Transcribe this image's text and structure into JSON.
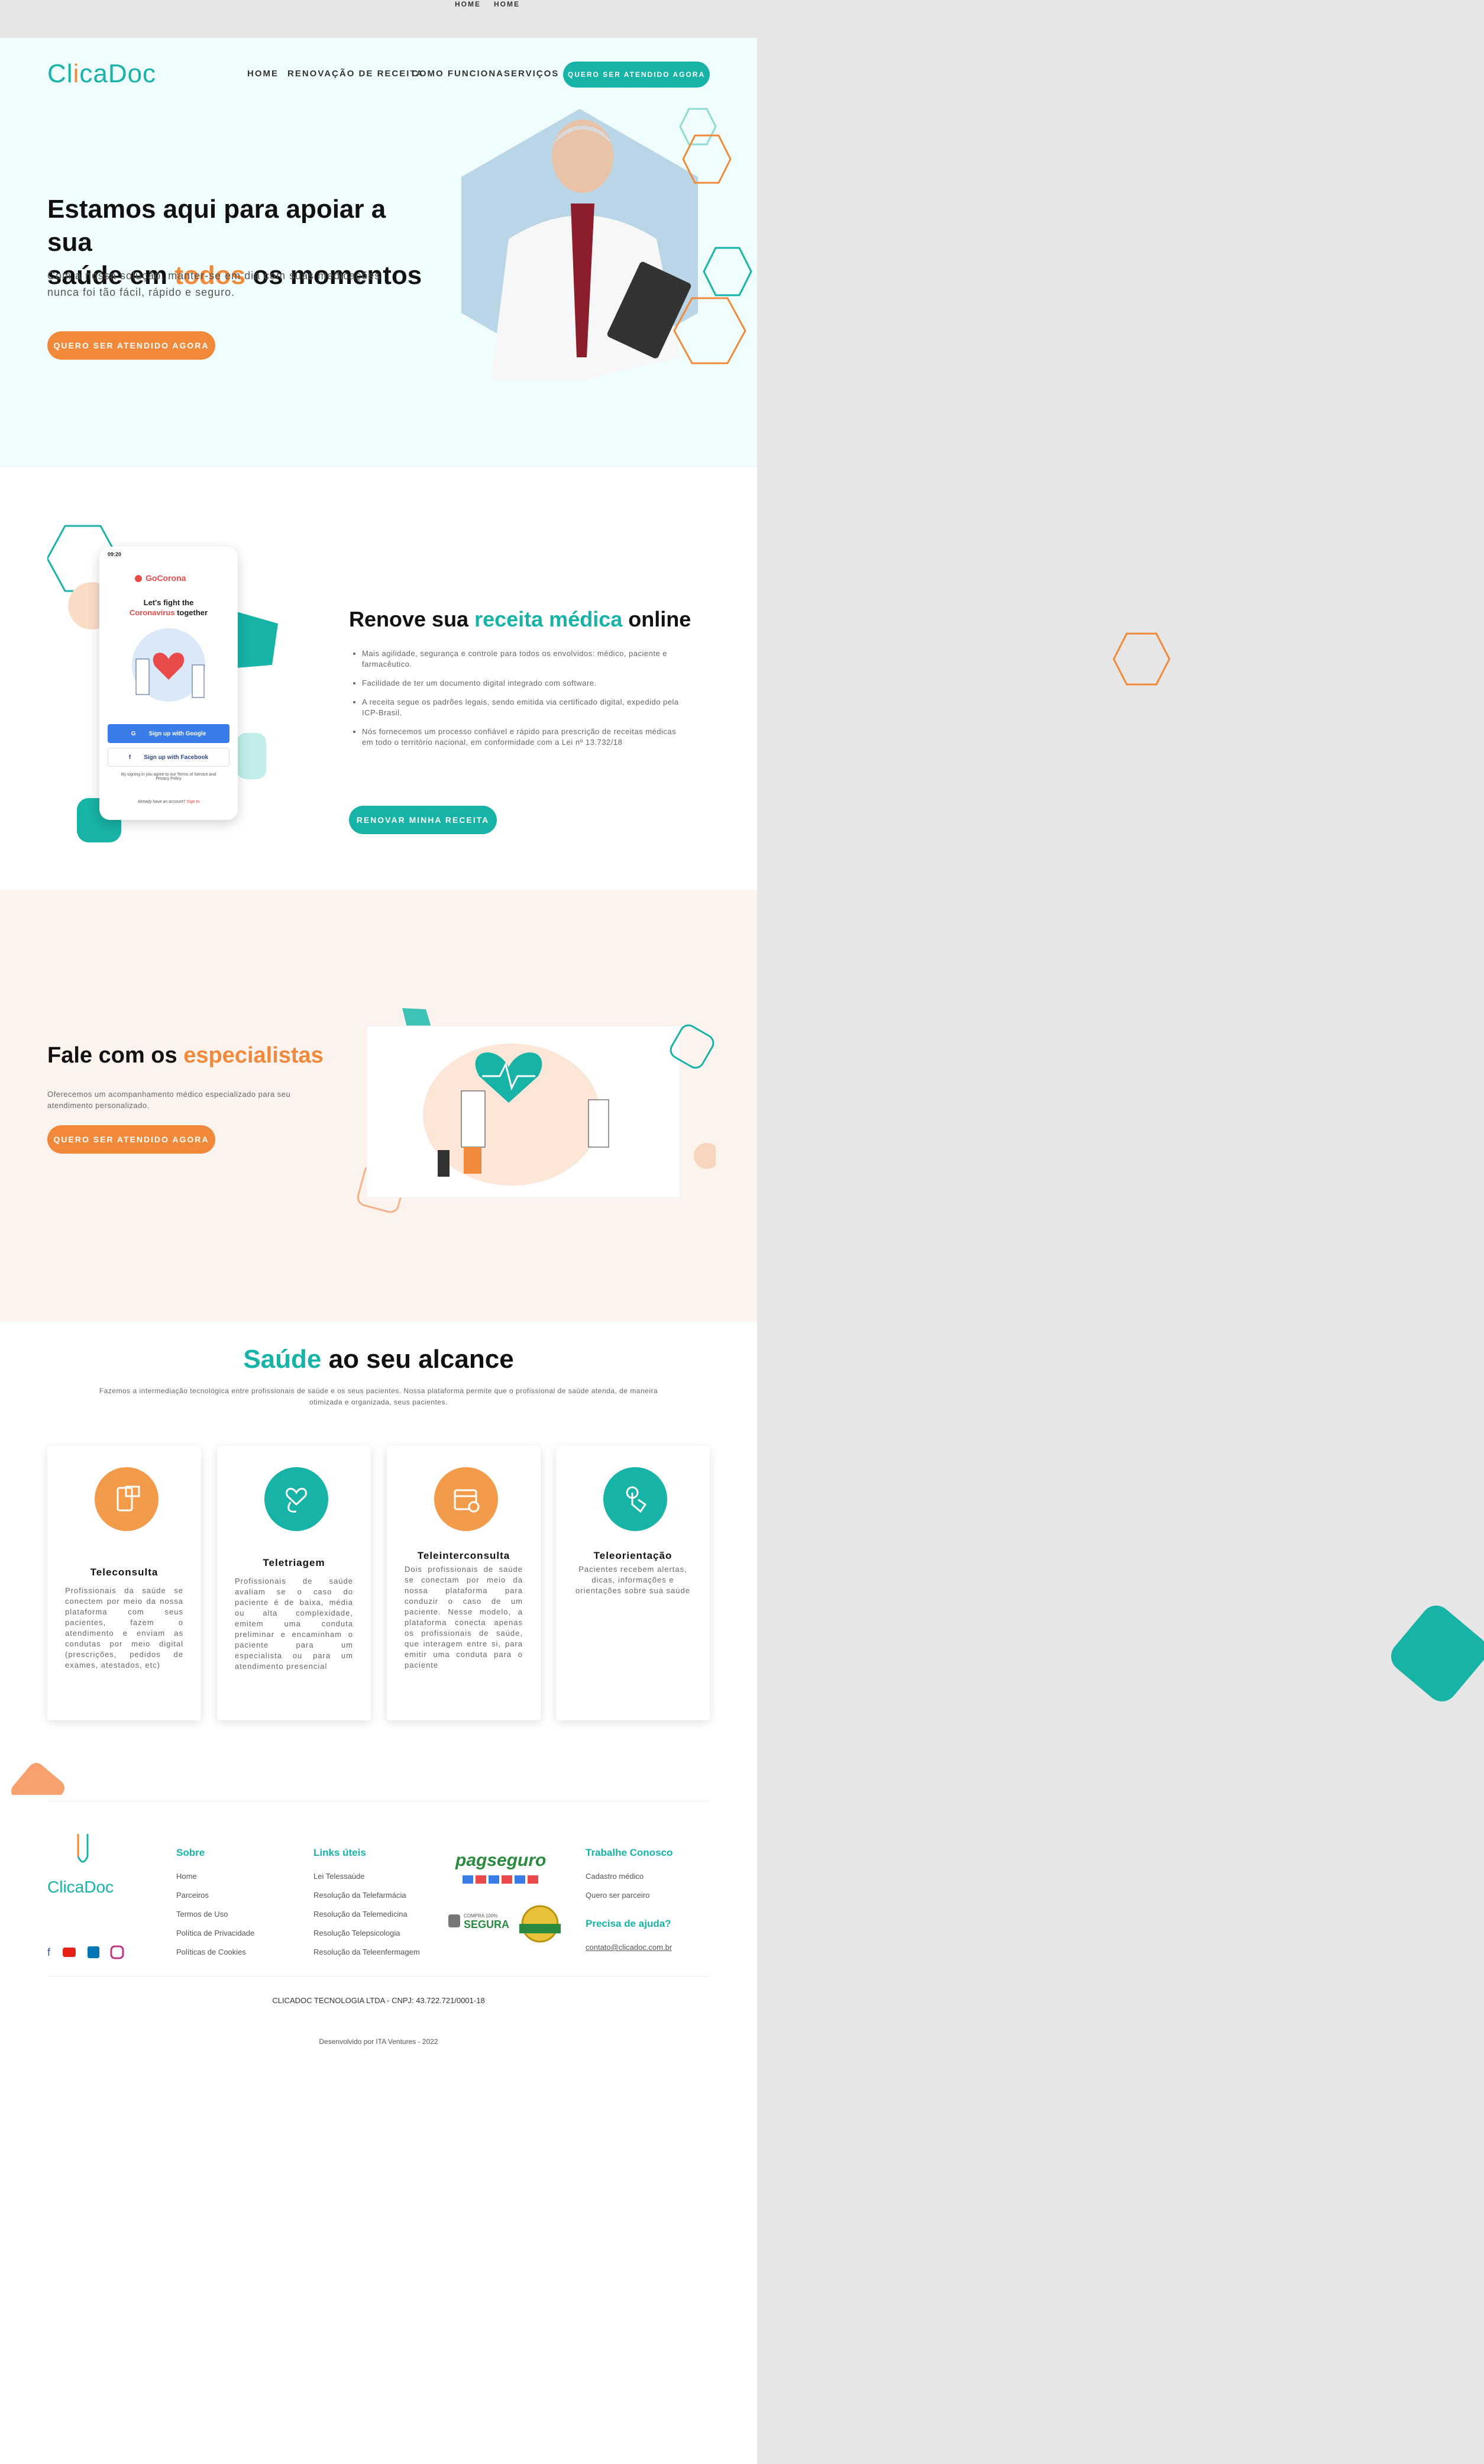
{
  "top_nav": [
    "HOME",
    "HOME"
  ],
  "brand": {
    "logo_a": "Cl",
    "logo_i": "i",
    "logo_b": "caDoc",
    "footer_logo": "ClicaDoc"
  },
  "nav": {
    "items": [
      "HOME",
      "RENOVAÇÃO DE RECEITA",
      "COMO FUNCIONA",
      "SERVIÇOS"
    ],
    "cta": "QUERO SER ATENDIDO AGORA"
  },
  "hero": {
    "t1": "Estamos aqui para apoiar a sua",
    "t2": "saúde em ",
    "t_hl": "todos",
    "t3": " os momentos",
    "subtitle": "Com a nossa solução, manter-se em dia com suas medicações nunca foi tão fácil, rápido e seguro.",
    "cta": "QUERO SER ATENDIDO AGORA"
  },
  "phone": {
    "time": "09:20",
    "app": "GoCorona",
    "headline1": "Let's fight the",
    "headline_hl": "Coronavirus",
    "headline2": "together",
    "google": "Sign up with Google",
    "facebook": "Sign up with Facebook",
    "terms": "By signing in you agree to our Terms of Service and Privacy Policy",
    "account": "Already have an account?",
    "signin": "Sign In"
  },
  "renew": {
    "t1": "Renove sua ",
    "t_hl": "receita médica",
    "t2": " online",
    "bullets": [
      "Mais agilidade, segurança e controle para todos os envolvidos: médico, paciente e farmacêutico.",
      "Facilidade de ter um documento digital integrado com software.",
      "A receita segue os padrões legais, sendo emitida via certificado digital, expedido pela ICP-Brasil.",
      "Nós fornecemos um processo confiável e rápido para prescrição de receitas médicas em todo o território nacional, em conformidade com a Lei nº 13.732/18"
    ],
    "cta": "RENOVAR MINHA RECEITA"
  },
  "specialists": {
    "t1": "Fale com os ",
    "t_hl": "especialistas",
    "desc": "Oferecemos um acompanhamento médico especializado para seu atendimento personalizado.",
    "cta": "QUERO SER ATENDIDO AGORA"
  },
  "reach": {
    "t_hl": "Saúde",
    "t1": " ao seu alcance",
    "desc": "Fazemos a intermediação tecnológica entre profissionais de saúde e os seus pacientes. Nossa plataforma permite que o profissional de saúde atenda, de maneira otimizada e organizada, seus pacientes.",
    "cards": [
      {
        "title": "Teleconsulta",
        "desc": "Profissionais da saúde se conectem por meio da nossa plataforma com seus pacientes, fazem o atendimento e enviam as condutas por meio digital (prescrições, pedidos de exames, atestados, etc)",
        "icon": "phone-icon"
      },
      {
        "title": "Teletriagem",
        "desc": "Profissionais de saúde avaliam se o caso do paciente é de baixa, média ou alta complexidade, emitem uma conduta preliminar e encaminham o paciente para um especialista ou para um atendimento presencial",
        "icon": "stethoscope-icon"
      },
      {
        "title": "Teleinterconsulta",
        "desc": "Dois profissionais de saúde se conectam por meio da nossa plataforma para conduzir o caso de um paciente. Nesse modelo, a plataforma conecta apenas os profissionais de saúde, que interagem entre si, para emitir uma conduta para o paciente",
        "icon": "calendar-icon"
      },
      {
        "title": "Teleorientação",
        "desc": "Pacientes recebem alertas, dicas, informações e orientações sobre sua saúde",
        "icon": "touch-icon"
      }
    ]
  },
  "footer": {
    "sobre": {
      "title": "Sobre",
      "links": [
        "Home",
        "Parceiros",
        "Termos de Uso",
        "Política de Privacidade",
        "Políticas de Cookies"
      ]
    },
    "links": {
      "title": "Links úteis",
      "links": [
        "Lei Telessaúde",
        "Resolução da Telefarmácia",
        "Resolução da Telemedicina",
        "Resolução Telepsicologia",
        "Resolução da Teleenfermagem"
      ]
    },
    "work": {
      "title": "Trabalhe Conosco",
      "links": [
        "Cadastro médico",
        "Quero ser parceiro"
      ]
    },
    "help": {
      "title": "Precisa de ajuda?",
      "email": "contato@clicadoc.com.br"
    },
    "pagseguro": "pagseguro",
    "secure": "SEGURA",
    "secure_top": "COMPRA 100%",
    "company": "CLICADOC TECNOLOGIA LTDA - CNPJ: 43.722.721/0001-18",
    "dev": "Desenvolvido por ITA Ventures - 2022"
  },
  "colors": {
    "teal": "#17b3a6",
    "orange": "#f08a3a"
  }
}
